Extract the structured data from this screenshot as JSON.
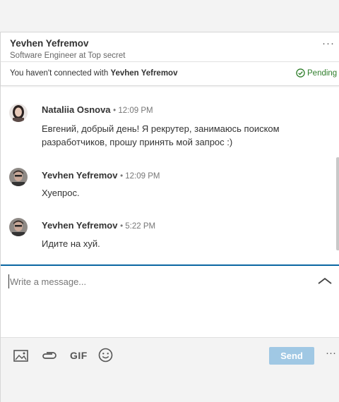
{
  "header": {
    "name": "Yevhen Yefremov",
    "title": "Software Engineer at Top secret",
    "more": "···"
  },
  "connection": {
    "prefix": "You haven't connected with ",
    "name": "Yevhen Yefremov",
    "status": "Pending",
    "status_color": "#2f7e2b"
  },
  "messages": [
    {
      "sender": "Nataliia Osnova",
      "time": "• 12:09 PM",
      "text": "Евгений, добрый день! Я рекрутер, занимаюсь поиском разработчиков, прошу принять мой запрос :)"
    },
    {
      "sender": "Yevhen Yefremov",
      "time": "• 12:09 PM",
      "text": "Хуепрос."
    },
    {
      "sender": "Yevhen Yefremov",
      "time": "• 5:22 PM",
      "text": "Идите на хуй."
    }
  ],
  "compose": {
    "placeholder": "Write a message..."
  },
  "toolbar": {
    "gif_label": "GIF",
    "send_label": "Send",
    "more": "···"
  },
  "colors": {
    "accent": "#0a66a2",
    "send_disabled": "#a0c8e4"
  },
  "icons": [
    "image-icon",
    "attachment-icon",
    "gif-icon",
    "emoji-icon",
    "chevron-up-icon",
    "check-circle-icon",
    "more-icon"
  ]
}
